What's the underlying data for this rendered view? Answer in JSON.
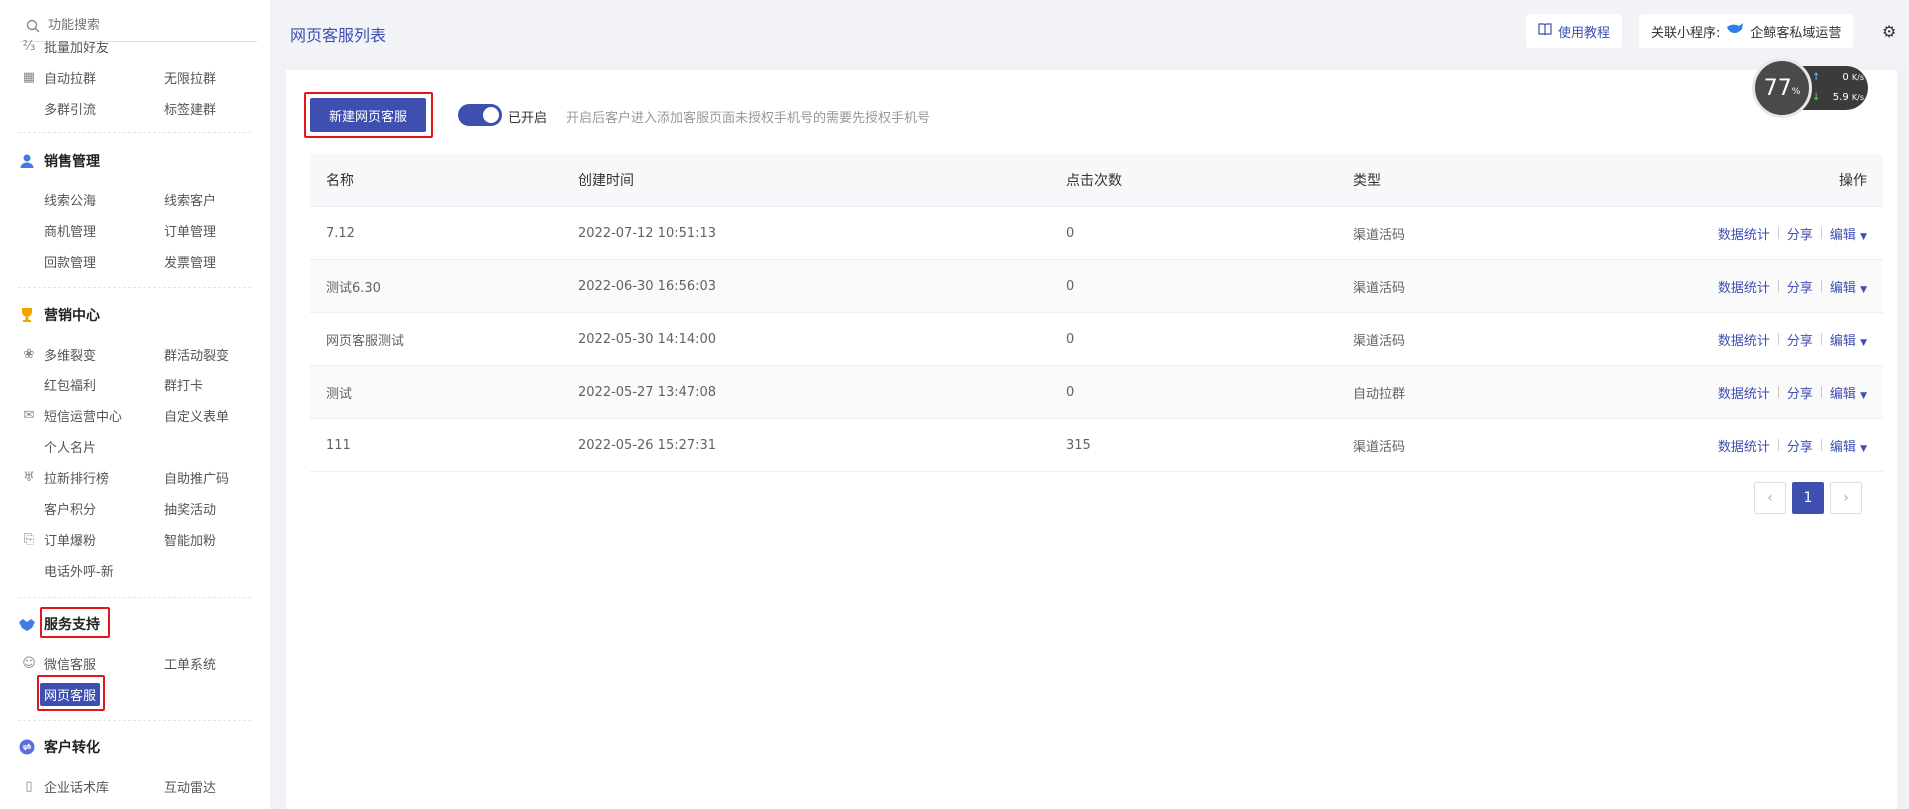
{
  "search": {
    "placeholder": "功能搜索"
  },
  "sidebar": {
    "top_items": [
      {
        "label": "批量加好友"
      },
      {
        "label": "自动拉群"
      },
      {
        "label": "无限拉群"
      },
      {
        "label": "多群引流"
      },
      {
        "label": "标签建群"
      }
    ],
    "sales": {
      "title": "销售管理",
      "items": [
        "线索公海",
        "线索客户",
        "商机管理",
        "订单管理",
        "回款管理",
        "发票管理"
      ]
    },
    "marketing": {
      "title": "营销中心",
      "items": [
        "多维裂变",
        "群活动裂变",
        "红包福利",
        "群打卡",
        "短信运营中心",
        "自定义表单",
        "个人名片",
        "拉新排行榜",
        "自助推广码",
        "客户积分",
        "抽奖活动",
        "订单爆粉",
        "智能加粉",
        "电话外呼-新"
      ]
    },
    "service": {
      "title": "服务支持",
      "items": [
        "微信客服",
        "工单系统",
        "网页客服"
      ]
    },
    "conversion": {
      "title": "客户转化",
      "items": [
        "企业话术库",
        "互动雷达"
      ]
    }
  },
  "header": {
    "title": "网页客服列表",
    "tutorial_label": "使用教程",
    "mini_program_label": "关联小程序:",
    "mini_program_name": "企鲸客私域运营"
  },
  "toolbar": {
    "new_button": "新建网页客服",
    "toggle_label": "已开启",
    "toggle_hint": "开启后客户进入添加客服页面未授权手机号的需要先授权手机号"
  },
  "table": {
    "columns": [
      "名称",
      "创建时间",
      "点击次数",
      "类型",
      "操作"
    ],
    "rows": [
      {
        "name": "7.12",
        "time": "2022-07-12 10:51:13",
        "clicks": "0",
        "type": "渠道活码"
      },
      {
        "name": "测试6.30",
        "time": "2022-06-30 16:56:03",
        "clicks": "0",
        "type": "渠道活码"
      },
      {
        "name": "网页客服测试",
        "time": "2022-05-30 14:14:00",
        "clicks": "0",
        "type": "渠道活码"
      },
      {
        "name": "测试",
        "time": "2022-05-27 13:47:08",
        "clicks": "0",
        "type": "自动拉群"
      },
      {
        "name": "111",
        "time": "2022-05-26 15:27:31",
        "clicks": "315",
        "type": "渠道活码"
      }
    ],
    "ops": {
      "stats": "数据统计",
      "share": "分享",
      "edit": "编辑"
    }
  },
  "pagination": {
    "current": "1"
  },
  "monitor": {
    "percent": "77",
    "percent_unit": "%",
    "up": "0",
    "up_unit": "K/s",
    "down": "5.9",
    "down_unit": "K/s"
  },
  "colors": {
    "accent": "#3f4fb0",
    "highlight": "#e0161a"
  }
}
